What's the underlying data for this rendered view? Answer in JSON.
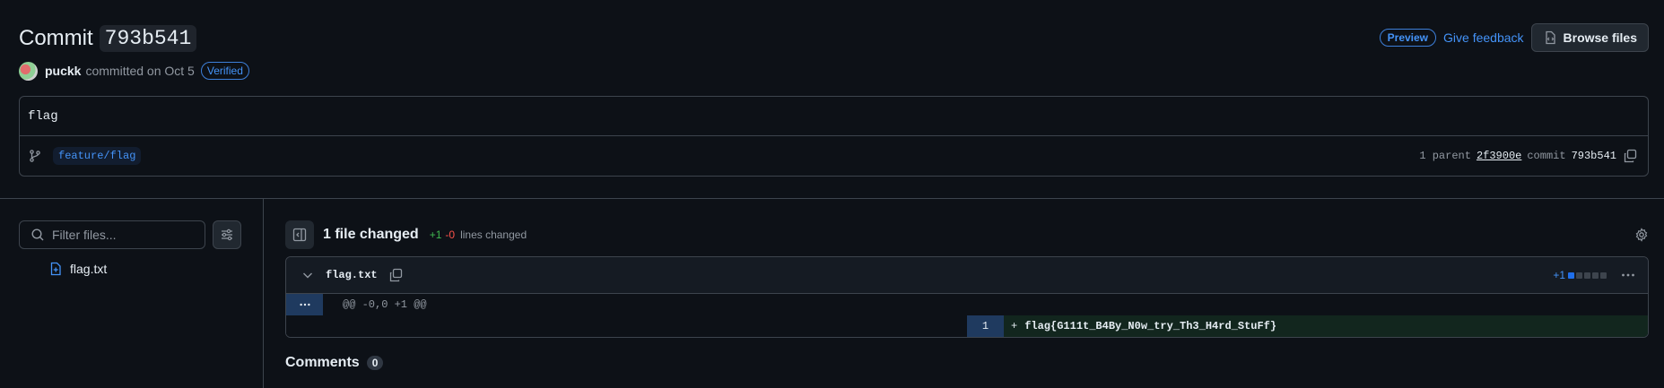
{
  "header": {
    "title_word": "Commit",
    "title_sha": "793b541",
    "author": "puckk",
    "committed_text": "committed on Oct 5",
    "verified_badge": "Verified",
    "preview_badge": "Preview",
    "feedback_link": "Give feedback",
    "browse_button": "Browse files"
  },
  "commit": {
    "message": "flag",
    "branch": "feature/flag",
    "parent_count_label": "1 parent",
    "parent_sha": "2f3900e",
    "commit_label": "commit",
    "commit_sha": "793b541"
  },
  "sidebar": {
    "filter_placeholder": "Filter files...",
    "files": [
      {
        "name": "flag.txt",
        "icon": "file-added-icon"
      }
    ]
  },
  "diff": {
    "files_changed": "1 file changed",
    "additions": "+1",
    "deletions": "-0",
    "lines_changed_label": "lines changed",
    "file": {
      "name": "flag.txt",
      "stat": "+1",
      "hunk_header": "@@ -0,0 +1 @@",
      "lines": [
        {
          "number": "1",
          "sign": "+",
          "text": "flag{G111t_B4By_N0w_try_Th3_H4rd_StuFf}"
        }
      ]
    }
  },
  "comments": {
    "title": "Comments",
    "count": "0"
  },
  "colors": {
    "background": "#0d1117",
    "accent_blue": "#4493f8",
    "addition_green": "#3fb950",
    "deletion_red": "#f85149",
    "border": "#3d444d"
  }
}
